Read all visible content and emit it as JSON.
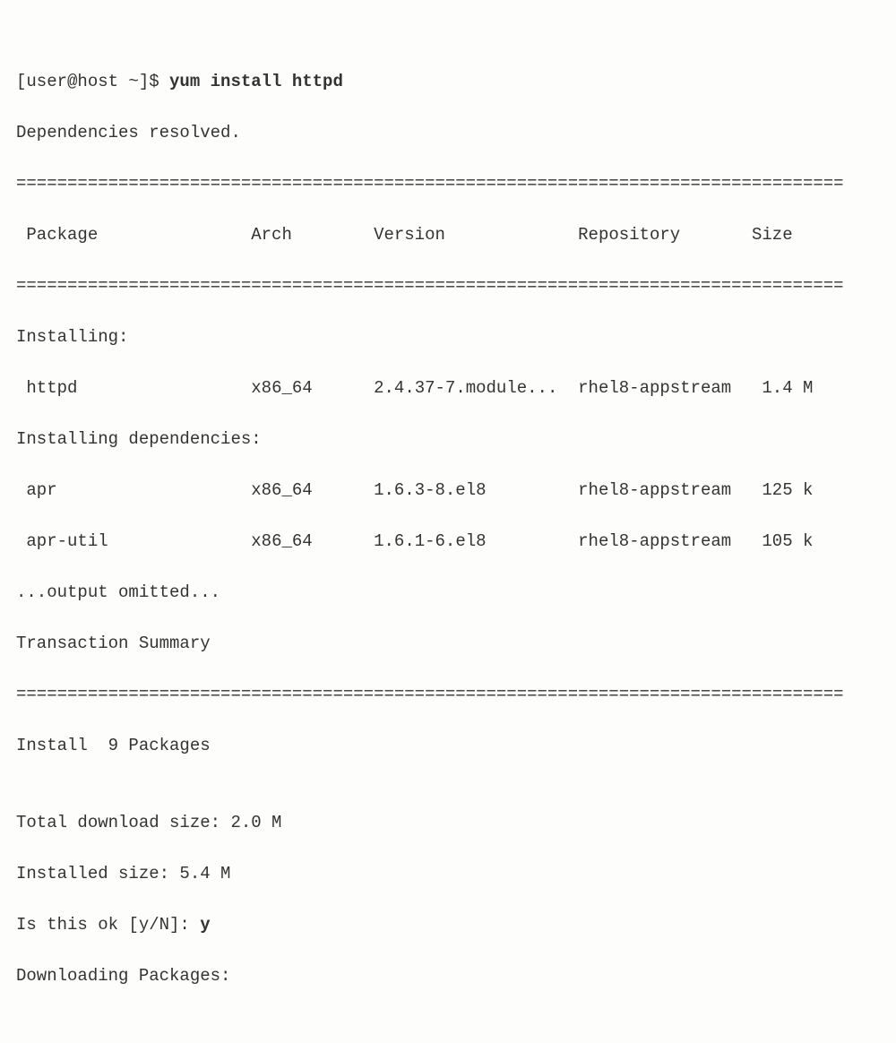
{
  "prompt": {
    "user_host": "[user@host ~]$ ",
    "command": "yum install httpd"
  },
  "status_resolved": "Dependencies resolved.",
  "divider": "=================================================================================",
  "header": {
    "package": " Package",
    "arch": "Arch",
    "version": "Version",
    "repository": "Repository",
    "size": "Size"
  },
  "installing_label": "Installing:",
  "installing_deps_label": "Installing dependencies:",
  "pkg_httpd": {
    "name": " httpd",
    "arch": "x86_64",
    "version": "2.4.37-7.module...",
    "repo": "rhel8-appstream",
    "size": "1.4 M"
  },
  "pkg_apr": {
    "name": " apr",
    "arch": "x86_64",
    "version": "1.6.3-8.el8",
    "repo": "rhel8-appstream",
    "size": "125 k"
  },
  "pkg_apr_util": {
    "name": " apr-util",
    "arch": "x86_64",
    "version": "1.6.1-6.el8",
    "repo": "rhel8-appstream",
    "size": "105 k"
  },
  "omitted": "...output omitted...",
  "txn_summary": "Transaction Summary",
  "install_count": "Install  9 Packages",
  "blank": "",
  "dl_size": "Total download size: 2.0 M",
  "inst_size": "Installed size: 5.4 M",
  "confirm_prompt": "Is this ok [y/N]: ",
  "confirm_answer": "y",
  "downloading": "Downloading Packages:"
}
